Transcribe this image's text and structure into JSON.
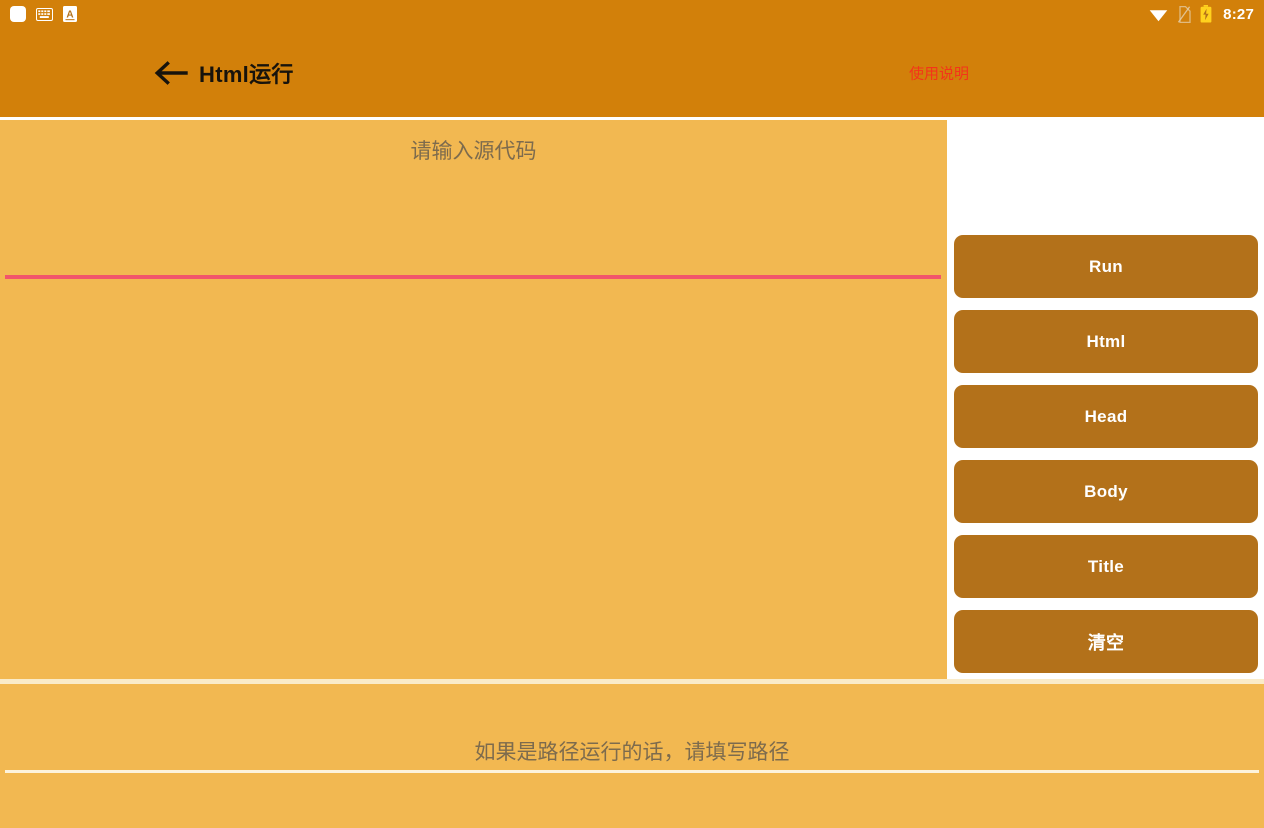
{
  "status_bar": {
    "icons_left": [
      {
        "name": "blank-app-icon",
        "glyph": "blank"
      },
      {
        "name": "keyboard-icon",
        "glyph": "keyboard"
      },
      {
        "name": "letter-a-icon",
        "glyph": "A"
      }
    ],
    "icons_right": [
      {
        "name": "wifi-icon",
        "glyph": "wifi"
      },
      {
        "name": "sim-card-off-icon",
        "glyph": "sim-off"
      },
      {
        "name": "battery-charging-icon",
        "glyph": "battery"
      }
    ],
    "time": "8:27"
  },
  "app_bar": {
    "back_icon": "back-arrow-icon",
    "title": "Html运行",
    "action_label": "使用说明",
    "background_color": "#D2800A",
    "title_color": "#17130C",
    "action_color": "#F4341A"
  },
  "editor": {
    "placeholder": "请输入源代码",
    "value": "",
    "underline_color": "#F2556B",
    "background_color": "#F2B851"
  },
  "buttons": [
    {
      "label": "Run",
      "name": "run-button",
      "cn": false
    },
    {
      "label": "Html",
      "name": "html-button",
      "cn": false
    },
    {
      "label": "Head",
      "name": "head-button",
      "cn": false
    },
    {
      "label": "Body",
      "name": "body-button",
      "cn": false
    },
    {
      "label": "Title",
      "name": "title-button",
      "cn": false
    },
    {
      "label": "清空",
      "name": "clear-button",
      "cn": true
    }
  ],
  "path_field": {
    "placeholder": "如果是路径运行的话，请填写路径",
    "value": "",
    "underline_color": "#FDF3DC"
  },
  "theme": {
    "button_color": "#B3711A",
    "panel_color": "#F2B851",
    "appbar_color": "#D2800A"
  }
}
